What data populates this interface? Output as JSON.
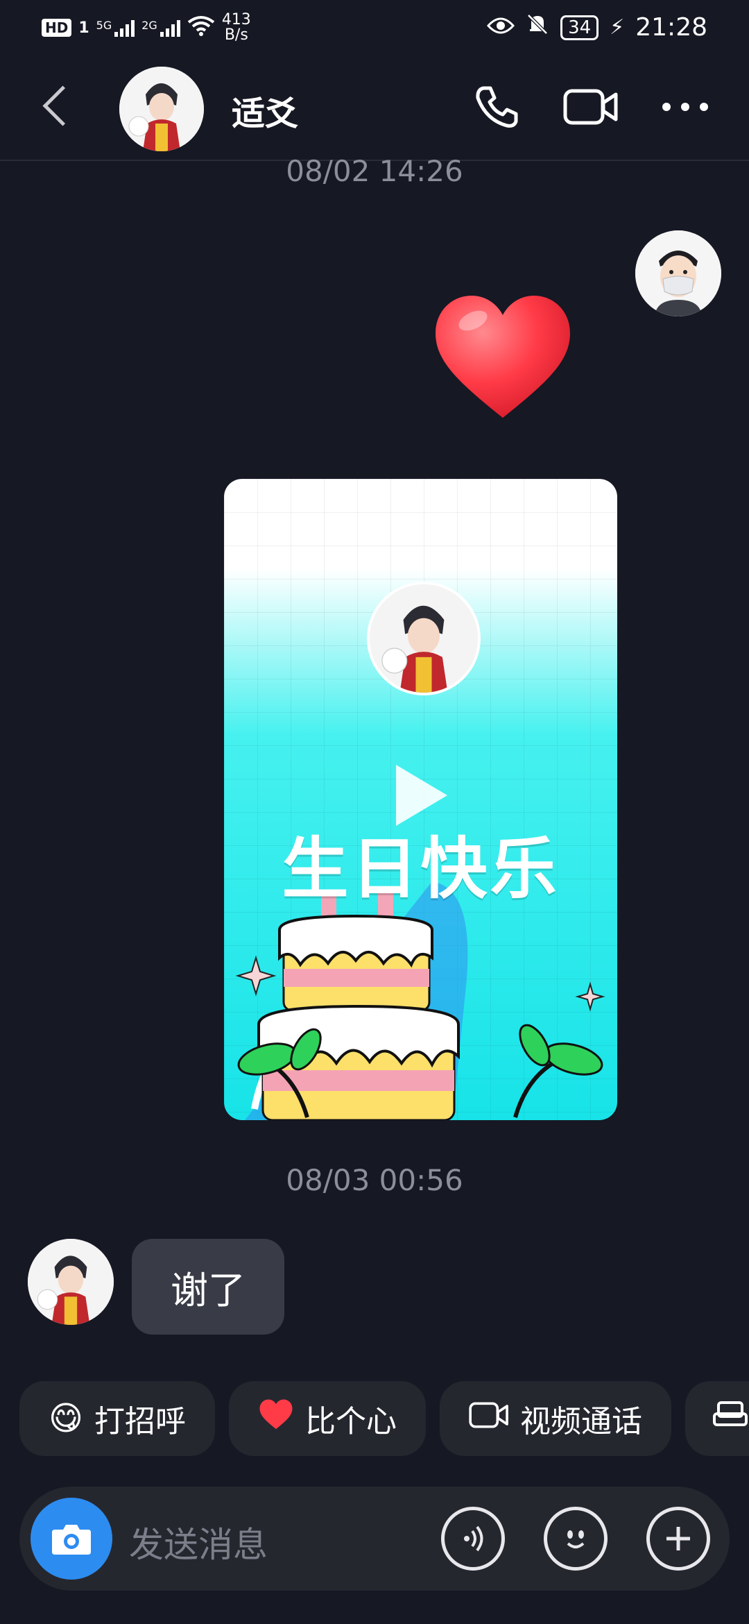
{
  "status_bar": {
    "hd_label": "HD",
    "sim1": "1",
    "sig1_label": "5G",
    "sig2_label": "2G",
    "net_speed_value": "413",
    "net_speed_unit": "B/s",
    "battery": "34",
    "time": "21:28"
  },
  "header": {
    "contact_name": "适爻"
  },
  "messages": {
    "timestamp_1": "08/02 14:26",
    "card_title": "生日快乐",
    "timestamp_2": "08/03 00:56",
    "reply_text": "谢了"
  },
  "quick_replies": [
    {
      "emoji": "😋",
      "label": "打招呼"
    },
    {
      "emoji": "❤️",
      "label": "比个心"
    },
    {
      "emoji": "",
      "label": "视频通话"
    }
  ],
  "input": {
    "placeholder": "发送消息"
  },
  "colors": {
    "background": "#161823",
    "bubble": "#393b46",
    "camera_button": "#2d8cf0",
    "heart": "#ff3b47"
  }
}
